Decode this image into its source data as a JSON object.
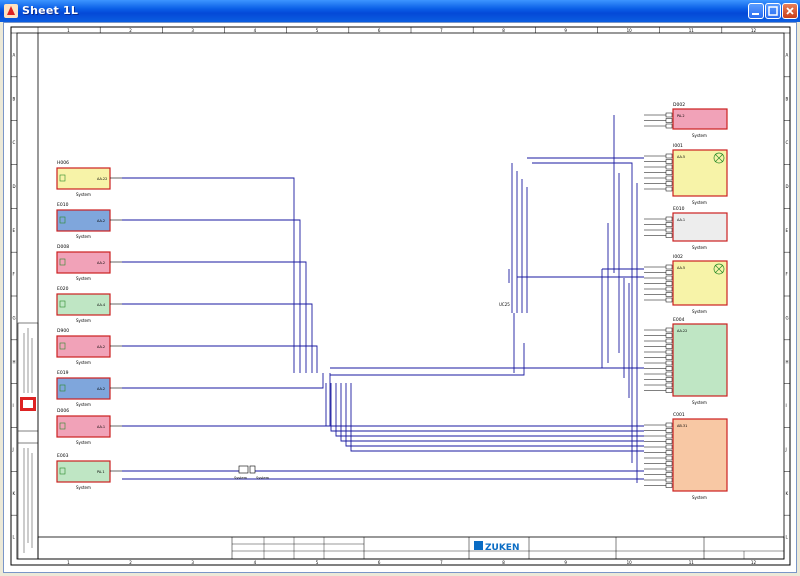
{
  "window": {
    "title": "Sheet 1L",
    "buttons": {
      "minimize": "minimize",
      "maximize": "maximize",
      "close": "close"
    }
  },
  "colors": {
    "wire": "#1a1aa0",
    "frame": "#000000",
    "box_border": "#cc2020",
    "yellow": "#f7f3a8",
    "blue": "#7fa6dc",
    "pink": "#f1a2b8",
    "green": "#bfe6c4",
    "grey": "#ededed",
    "orange": "#f8c8a4",
    "zuken_blue": "#0a6cc4"
  },
  "ruler": {
    "top": [
      "1",
      "2",
      "3",
      "4",
      "5",
      "6",
      "7",
      "8",
      "9",
      "10",
      "11",
      "12"
    ],
    "side": [
      "A",
      "B",
      "C",
      "D",
      "E",
      "F",
      "G",
      "H",
      "I",
      "J",
      "K",
      "L"
    ]
  },
  "left_components": [
    {
      "id": "H006",
      "pin": "AA.22",
      "caption": "System",
      "color": "yellow"
    },
    {
      "id": "E010",
      "pin": "AA.2",
      "caption": "System",
      "color": "blue"
    },
    {
      "id": "D008",
      "pin": "AA.2",
      "caption": "System",
      "color": "pink"
    },
    {
      "id": "E020",
      "pin": "AA.4",
      "caption": "System",
      "color": "green"
    },
    {
      "id": "D900",
      "pin": "AA.2",
      "caption": "System",
      "color": "pink"
    },
    {
      "id": "E019",
      "pin": "AA.2",
      "caption": "System",
      "color": "blue"
    },
    {
      "id": "D006",
      "pin": "AA.1",
      "caption": "System",
      "color": "pink"
    },
    {
      "id": "E003",
      "pin": "PA.1",
      "caption": "System",
      "color": "green"
    }
  ],
  "right_components": [
    {
      "id": "D002",
      "pin": "PA.2",
      "caption": "System",
      "color": "pink"
    },
    {
      "id": "I001",
      "pin": "AA.5",
      "caption": "System",
      "color": "yellow"
    },
    {
      "id": "E010",
      "pin": "AA.1",
      "caption": "System",
      "color": "grey"
    },
    {
      "id": "I002",
      "pin": "AA.5",
      "caption": "System",
      "color": "yellow"
    },
    {
      "id": "E004",
      "pin": "AA.22",
      "caption": "System",
      "color": "green"
    },
    {
      "id": "C001",
      "pin": "AB.31",
      "caption": "System",
      "color": "orange"
    }
  ],
  "connector_labels": {
    "mid_left": "System",
    "mid_right": "System",
    "hub": "UC25"
  },
  "title_block": {
    "company": "ZUKEN"
  }
}
